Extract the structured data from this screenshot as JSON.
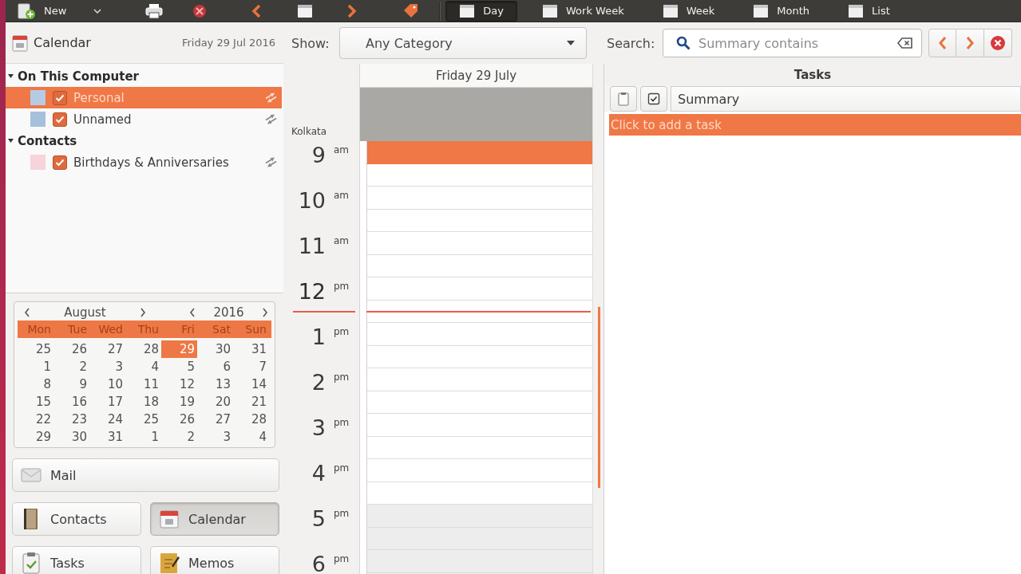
{
  "toolbar": {
    "new_label": "New",
    "views": [
      {
        "label": "Day",
        "selected": true
      },
      {
        "label": "Work Week",
        "selected": false
      },
      {
        "label": "Week",
        "selected": false
      },
      {
        "label": "Month",
        "selected": false
      },
      {
        "label": "List",
        "selected": false
      }
    ]
  },
  "sidebar": {
    "title": "Calendar",
    "date": "Friday 29 Jul 2016",
    "groups": [
      {
        "label": "On This Computer",
        "expanded": true,
        "children": [
          {
            "label": "Personal",
            "color": "#b5cbe4",
            "checked": true,
            "selected": true
          },
          {
            "label": "Unnamed",
            "color": "#a6c0dc",
            "checked": true,
            "selected": false
          }
        ]
      },
      {
        "label": "Contacts",
        "expanded": true,
        "children": [
          {
            "label": "Birthdays & Anniversaries",
            "color": "#f7d3dc",
            "checked": true,
            "selected": false
          }
        ]
      }
    ]
  },
  "mini_calendar": {
    "month": "August",
    "year": "2016",
    "weekdays": [
      "Mon",
      "Tue",
      "Wed",
      "Thu",
      "Fri",
      "Sat",
      "Sun"
    ],
    "weeks": [
      [
        {
          "day": "25",
          "selected": false
        },
        {
          "day": "26",
          "selected": false
        },
        {
          "day": "27",
          "selected": false
        },
        {
          "day": "28",
          "selected": false
        },
        {
          "day": "29",
          "selected": true
        },
        {
          "day": "30",
          "selected": false
        },
        {
          "day": "31",
          "selected": false
        }
      ],
      [
        {
          "day": "1",
          "selected": false
        },
        {
          "day": "2",
          "selected": false
        },
        {
          "day": "3",
          "selected": false
        },
        {
          "day": "4",
          "selected": false
        },
        {
          "day": "5",
          "selected": false
        },
        {
          "day": "6",
          "selected": false
        },
        {
          "day": "7",
          "selected": false
        }
      ],
      [
        {
          "day": "8",
          "selected": false
        },
        {
          "day": "9",
          "selected": false
        },
        {
          "day": "10",
          "selected": false
        },
        {
          "day": "11",
          "selected": false
        },
        {
          "day": "12",
          "selected": false
        },
        {
          "day": "13",
          "selected": false
        },
        {
          "day": "14",
          "selected": false
        }
      ],
      [
        {
          "day": "15",
          "selected": false
        },
        {
          "day": "16",
          "selected": false
        },
        {
          "day": "17",
          "selected": false
        },
        {
          "day": "18",
          "selected": false
        },
        {
          "day": "19",
          "selected": false
        },
        {
          "day": "20",
          "selected": false
        },
        {
          "day": "21",
          "selected": false
        }
      ],
      [
        {
          "day": "22",
          "selected": false
        },
        {
          "day": "23",
          "selected": false
        },
        {
          "day": "24",
          "selected": false
        },
        {
          "day": "25",
          "selected": false
        },
        {
          "day": "26",
          "selected": false
        },
        {
          "day": "27",
          "selected": false
        },
        {
          "day": "28",
          "selected": false
        }
      ],
      [
        {
          "day": "29",
          "selected": false
        },
        {
          "day": "30",
          "selected": false
        },
        {
          "day": "31",
          "selected": false
        },
        {
          "day": "1",
          "selected": false
        },
        {
          "day": "2",
          "selected": false
        },
        {
          "day": "3",
          "selected": false
        },
        {
          "day": "4",
          "selected": false
        }
      ]
    ]
  },
  "switcher": [
    {
      "kind": "mail",
      "label": "Mail",
      "selected": false
    },
    {
      "kind": "contacts",
      "label": "Contacts",
      "selected": false
    },
    {
      "kind": "calendar",
      "label": "Calendar",
      "selected": true
    },
    {
      "kind": "tasks",
      "label": "Tasks",
      "selected": false
    },
    {
      "kind": "memos",
      "label": "Memos",
      "selected": false
    }
  ],
  "filter": {
    "label": "Show:",
    "value": "Any Category"
  },
  "search": {
    "label": "Search:",
    "placeholder": "Summary contains"
  },
  "day_view": {
    "header": "Friday 29 July",
    "timezone": "Kolkata",
    "hours": [
      {
        "hour": "9",
        "suffix": "am",
        "now": false,
        "slots": [
          {
            "selected": true,
            "working": true
          },
          {
            "selected": false,
            "working": true
          }
        ]
      },
      {
        "hour": "10",
        "suffix": "am",
        "now": false,
        "slots": [
          {
            "selected": false,
            "working": true
          },
          {
            "selected": false,
            "working": true
          }
        ]
      },
      {
        "hour": "11",
        "suffix": "am",
        "now": false,
        "slots": [
          {
            "selected": false,
            "working": true
          },
          {
            "selected": false,
            "working": true
          }
        ]
      },
      {
        "hour": "12",
        "suffix": "pm",
        "now": true,
        "slots": [
          {
            "selected": false,
            "working": true
          },
          {
            "selected": false,
            "working": true
          }
        ]
      },
      {
        "hour": "1",
        "suffix": "pm",
        "now": false,
        "slots": [
          {
            "selected": false,
            "working": true
          },
          {
            "selected": false,
            "working": true
          }
        ]
      },
      {
        "hour": "2",
        "suffix": "pm",
        "now": false,
        "slots": [
          {
            "selected": false,
            "working": true
          },
          {
            "selected": false,
            "working": true
          }
        ]
      },
      {
        "hour": "3",
        "suffix": "pm",
        "now": false,
        "slots": [
          {
            "selected": false,
            "working": true
          },
          {
            "selected": false,
            "working": true
          }
        ]
      },
      {
        "hour": "4",
        "suffix": "pm",
        "now": false,
        "slots": [
          {
            "selected": false,
            "working": true
          },
          {
            "selected": false,
            "working": true
          }
        ]
      },
      {
        "hour": "5",
        "suffix": "pm",
        "now": false,
        "slots": [
          {
            "selected": false,
            "working": false
          },
          {
            "selected": false,
            "working": false
          }
        ]
      },
      {
        "hour": "6",
        "suffix": "pm",
        "now": false,
        "slots": [
          {
            "selected": false,
            "working": false
          },
          {
            "selected": false,
            "working": false
          }
        ]
      }
    ]
  },
  "tasks": {
    "title": "Tasks",
    "column": "Summary",
    "add_row": {
      "label": "Click to add a task",
      "selected": true
    }
  }
}
